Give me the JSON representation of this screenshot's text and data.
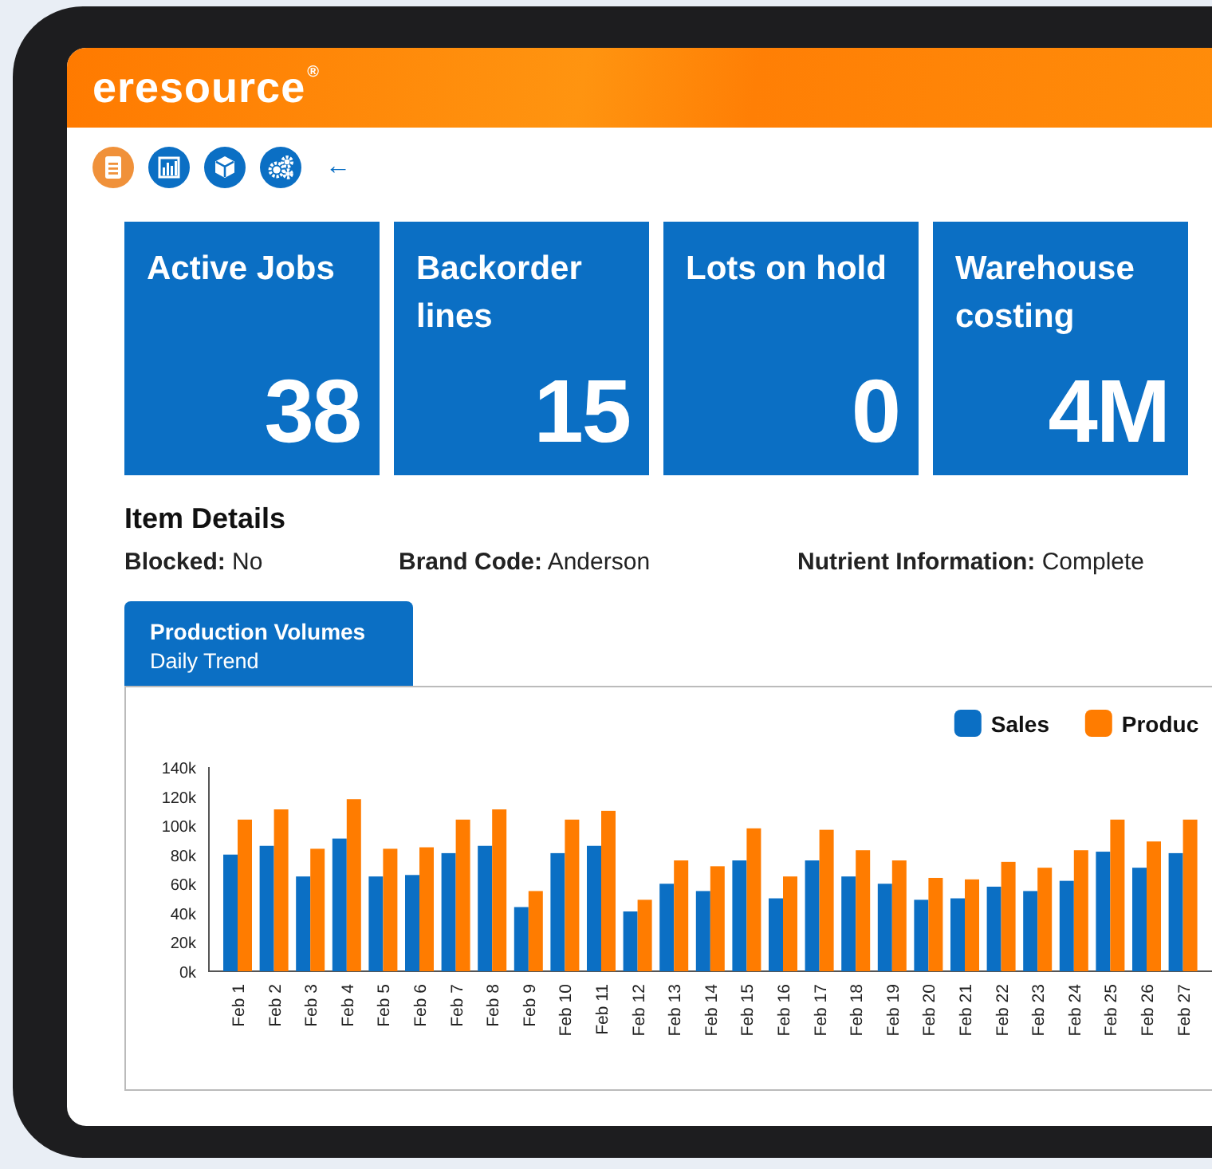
{
  "header": {
    "logo": "eresource",
    "logo_mark": "®"
  },
  "toolbar": {
    "items": [
      {
        "kind": "document",
        "selected": true
      },
      {
        "kind": "chart",
        "selected": false
      },
      {
        "kind": "cube",
        "selected": false
      },
      {
        "kind": "gears",
        "selected": false
      }
    ],
    "back": "←"
  },
  "kpis": [
    {
      "label": "Active Jobs",
      "value": "38"
    },
    {
      "label": "Backorder lines",
      "value": "15"
    },
    {
      "label": "Lots on hold",
      "value": "0"
    },
    {
      "label": "Warehouse costing",
      "value": "4M"
    }
  ],
  "item_details": {
    "title": "Item Details",
    "fields": [
      {
        "label": "Blocked:",
        "value": "No"
      },
      {
        "label": "Brand Code:",
        "value": "Anderson"
      },
      {
        "label": "Nutrient Information:",
        "value": "Complete"
      }
    ]
  },
  "chart_tab": {
    "title": "Production Volumes",
    "subtitle": "Daily Trend",
    "selected": true
  },
  "chart_data": {
    "type": "bar",
    "categories": [
      "Feb 1",
      "Feb 2",
      "Feb 3",
      "Feb 4",
      "Feb 5",
      "Feb 6",
      "Feb 7",
      "Feb 8",
      "Feb 9",
      "Feb 10",
      "Feb 11",
      "Feb 12",
      "Feb 13",
      "Feb 14",
      "Feb 15",
      "Feb 16",
      "Feb 17",
      "Feb 18",
      "Feb 19",
      "Feb 20",
      "Feb 21",
      "Feb 22",
      "Feb 23",
      "Feb 24",
      "Feb 25",
      "Feb 26",
      "Feb 27"
    ],
    "series": [
      {
        "name": "Sales",
        "color": "#0b6fc4",
        "values": [
          80000,
          86000,
          65000,
          91000,
          65000,
          66000,
          81000,
          86000,
          44000,
          81000,
          86000,
          41000,
          60000,
          55000,
          76000,
          50000,
          76000,
          65000,
          60000,
          49000,
          50000,
          58000,
          55000,
          62000,
          82000,
          71000,
          81000
        ]
      },
      {
        "name": "Produc",
        "color": "#ff7c00",
        "values": [
          104000,
          111000,
          84000,
          118000,
          84000,
          85000,
          104000,
          111000,
          55000,
          104000,
          110000,
          49000,
          76000,
          72000,
          98000,
          65000,
          97000,
          83000,
          76000,
          64000,
          63000,
          75000,
          71000,
          83000,
          104000,
          89000,
          104000
        ]
      }
    ],
    "ylim": [
      0,
      140000
    ],
    "legend": true,
    "yticks": [
      {
        "value": 0,
        "label": "0k"
      },
      {
        "value": 20000,
        "label": "20k"
      },
      {
        "value": 40000,
        "label": "40k"
      },
      {
        "value": 60000,
        "label": "60k"
      },
      {
        "value": 80000,
        "label": "80k"
      },
      {
        "value": 100000,
        "label": "100k"
      },
      {
        "value": 120000,
        "label": "120k"
      },
      {
        "value": 140000,
        "label": "140k"
      }
    ]
  }
}
